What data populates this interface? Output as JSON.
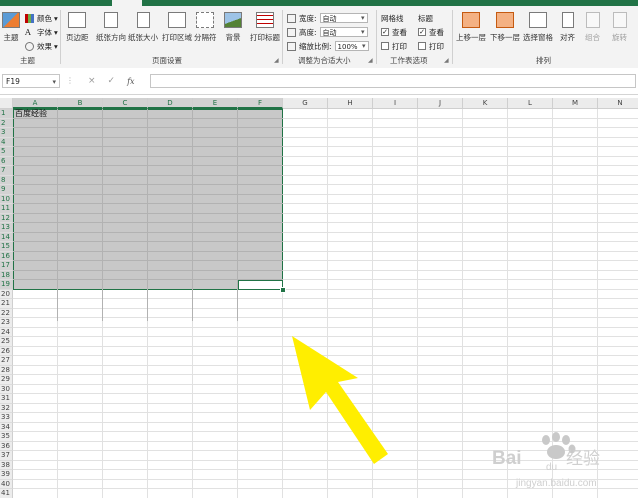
{
  "name_box": "F19",
  "formula_bar": {
    "cancel_glyph": "×",
    "enter_glyph": "✓",
    "fx_glyph": "fx",
    "value": ""
  },
  "ribbon": {
    "themes": {
      "themes_label": "主题",
      "colors_label": "颜色",
      "fonts_label": "字体",
      "effects_label": "效果",
      "group_label": "主题"
    },
    "page_setup": {
      "margins_label": "页边距",
      "orientation_label": "纸张方向",
      "size_label": "纸张大小",
      "print_area_label": "打印区域",
      "breaks_label": "分隔符",
      "background_label": "背景",
      "print_titles_label": "打印标题",
      "group_label": "页面设置"
    },
    "scale_to_fit": {
      "width_label": "宽度:",
      "width_value": "自动",
      "height_label": "高度:",
      "height_value": "自动",
      "scale_label": "缩放比例:",
      "scale_value": "100%",
      "group_label": "调整为合适大小"
    },
    "sheet_options": {
      "gridlines_label": "网格线",
      "headings_label": "标题",
      "view_label": "查看",
      "print_label": "打印",
      "gridlines_view_checked": true,
      "gridlines_print_checked": false,
      "headings_view_checked": true,
      "headings_print_checked": false,
      "group_label": "工作表选项"
    },
    "arrange": {
      "bring_forward_label": "上移一层",
      "send_backward_label": "下移一层",
      "selection_pane_label": "选择窗格",
      "align_label": "对齐",
      "group_label_btn": "组合",
      "rotate_label": "旋转",
      "group_label": "排列"
    }
  },
  "grid": {
    "columns": [
      "A",
      "B",
      "C",
      "D",
      "E",
      "F",
      "G",
      "H",
      "I",
      "J",
      "K",
      "L",
      "M",
      "N"
    ],
    "rows": [
      "1",
      "2",
      "3",
      "4",
      "5",
      "6",
      "7",
      "8",
      "9",
      "10",
      "11",
      "12",
      "13",
      "14",
      "15",
      "16",
      "17",
      "18",
      "19",
      "20",
      "21",
      "22",
      "23",
      "24",
      "25",
      "26",
      "27",
      "28",
      "29",
      "30",
      "31",
      "32",
      "33",
      "34",
      "35",
      "36",
      "37",
      "38",
      "39",
      "40",
      "41"
    ],
    "selected_columns": [
      "A",
      "B",
      "C",
      "D",
      "E",
      "F"
    ],
    "selected_row_count": 19,
    "cell_A1": "百度经验"
  },
  "watermark": {
    "brand": "Bai",
    "brand_du": "du",
    "suffix": "经验",
    "url": "jingyan.baidu.com"
  },
  "colors": {
    "accent": "#217346",
    "arrow": "#ffee00",
    "selection_fill": "#c8c8c8"
  }
}
